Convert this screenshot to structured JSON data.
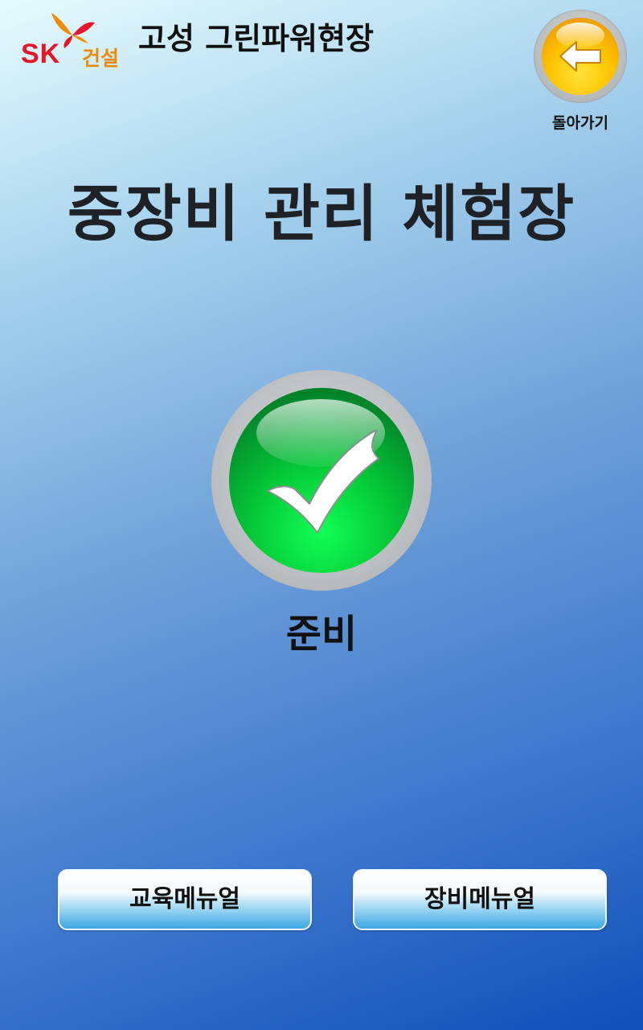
{
  "header": {
    "logo_text": "SK",
    "logo_korean": "건설",
    "site_title": "고성 그린파워현장",
    "back_label": "돌아가기"
  },
  "main": {
    "title": "중장비 관리 체험장",
    "status_label": "준비"
  },
  "buttons": {
    "education_manual": "교육메뉴얼",
    "equipment_manual": "장비메뉴얼"
  },
  "colors": {
    "brand_red": "#e3162c",
    "brand_orange": "#f08a00",
    "status_green": "#05c938",
    "back_yellow": "#ffc400"
  },
  "icons": {
    "back": "left-arrow-icon",
    "status": "check-mark-icon",
    "logo": "butterfly-logo-icon"
  }
}
